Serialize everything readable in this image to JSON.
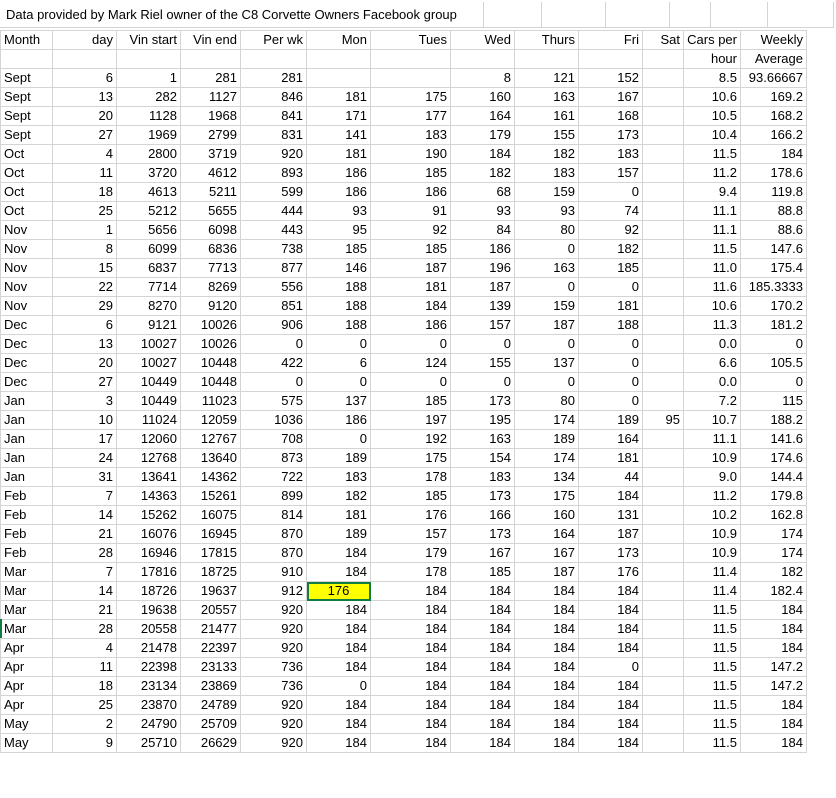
{
  "title": "Data provided by Mark Riel owner of the C8 Corvette Owners Facebook group",
  "headers": [
    "Month",
    "day",
    "Vin start",
    "Vin end",
    "Per wk",
    "Mon",
    "Tues",
    "Wed",
    "Thurs",
    "Fri",
    "Sat",
    "Cars per",
    "Weekly"
  ],
  "headers2": [
    "",
    "",
    "",
    "",
    "",
    "",
    "",
    "",
    "",
    "",
    "",
    "hour",
    "Average"
  ],
  "highlight": {
    "row": 27,
    "col": 5,
    "color": "#ffff00"
  },
  "rows": [
    [
      "Sept",
      "6",
      "1",
      "281",
      "281",
      "",
      "",
      "8",
      "121",
      "152",
      "",
      "8.5",
      "93.66667"
    ],
    [
      "Sept",
      "13",
      "282",
      "1127",
      "846",
      "181",
      "175",
      "160",
      "163",
      "167",
      "",
      "10.6",
      "169.2"
    ],
    [
      "Sept",
      "20",
      "1128",
      "1968",
      "841",
      "171",
      "177",
      "164",
      "161",
      "168",
      "",
      "10.5",
      "168.2"
    ],
    [
      "Sept",
      "27",
      "1969",
      "2799",
      "831",
      "141",
      "183",
      "179",
      "155",
      "173",
      "",
      "10.4",
      "166.2"
    ],
    [
      "Oct",
      "4",
      "2800",
      "3719",
      "920",
      "181",
      "190",
      "184",
      "182",
      "183",
      "",
      "11.5",
      "184"
    ],
    [
      "Oct",
      "11",
      "3720",
      "4612",
      "893",
      "186",
      "185",
      "182",
      "183",
      "157",
      "",
      "11.2",
      "178.6"
    ],
    [
      "Oct",
      "18",
      "4613",
      "5211",
      "599",
      "186",
      "186",
      "68",
      "159",
      "0",
      "",
      "9.4",
      "119.8"
    ],
    [
      "Oct",
      "25",
      "5212",
      "5655",
      "444",
      "93",
      "91",
      "93",
      "93",
      "74",
      "",
      "11.1",
      "88.8"
    ],
    [
      "Nov",
      "1",
      "5656",
      "6098",
      "443",
      "95",
      "92",
      "84",
      "80",
      "92",
      "",
      "11.1",
      "88.6"
    ],
    [
      "Nov",
      "8",
      "6099",
      "6836",
      "738",
      "185",
      "185",
      "186",
      "0",
      "182",
      "",
      "11.5",
      "147.6"
    ],
    [
      "Nov",
      "15",
      "6837",
      "7713",
      "877",
      "146",
      "187",
      "196",
      "163",
      "185",
      "",
      "11.0",
      "175.4"
    ],
    [
      "Nov",
      "22",
      "7714",
      "8269",
      "556",
      "188",
      "181",
      "187",
      "0",
      "0",
      "",
      "11.6",
      "185.3333"
    ],
    [
      "Nov",
      "29",
      "8270",
      "9120",
      "851",
      "188",
      "184",
      "139",
      "159",
      "181",
      "",
      "10.6",
      "170.2"
    ],
    [
      "Dec",
      "6",
      "9121",
      "10026",
      "906",
      "188",
      "186",
      "157",
      "187",
      "188",
      "",
      "11.3",
      "181.2"
    ],
    [
      "Dec",
      "13",
      "10027",
      "10026",
      "0",
      "0",
      "0",
      "0",
      "0",
      "0",
      "",
      "0.0",
      "0"
    ],
    [
      "Dec",
      "20",
      "10027",
      "10448",
      "422",
      "6",
      "124",
      "155",
      "137",
      "0",
      "",
      "6.6",
      "105.5"
    ],
    [
      "Dec",
      "27",
      "10449",
      "10448",
      "0",
      "0",
      "0",
      "0",
      "0",
      "0",
      "",
      "0.0",
      "0"
    ],
    [
      "Jan",
      "3",
      "10449",
      "11023",
      "575",
      "137",
      "185",
      "173",
      "80",
      "0",
      "",
      "7.2",
      "115"
    ],
    [
      "Jan",
      "10",
      "11024",
      "12059",
      "1036",
      "186",
      "197",
      "195",
      "174",
      "189",
      "95",
      "10.7",
      "188.2"
    ],
    [
      "Jan",
      "17",
      "12060",
      "12767",
      "708",
      "0",
      "192",
      "163",
      "189",
      "164",
      "",
      "11.1",
      "141.6"
    ],
    [
      "Jan",
      "24",
      "12768",
      "13640",
      "873",
      "189",
      "175",
      "154",
      "174",
      "181",
      "",
      "10.9",
      "174.6"
    ],
    [
      "Jan",
      "31",
      "13641",
      "14362",
      "722",
      "183",
      "178",
      "183",
      "134",
      "44",
      "",
      "9.0",
      "144.4"
    ],
    [
      "Feb",
      "7",
      "14363",
      "15261",
      "899",
      "182",
      "185",
      "173",
      "175",
      "184",
      "",
      "11.2",
      "179.8"
    ],
    [
      "Feb",
      "14",
      "15262",
      "16075",
      "814",
      "181",
      "176",
      "166",
      "160",
      "131",
      "",
      "10.2",
      "162.8"
    ],
    [
      "Feb",
      "21",
      "16076",
      "16945",
      "870",
      "189",
      "157",
      "173",
      "164",
      "187",
      "",
      "10.9",
      "174"
    ],
    [
      "Feb",
      "28",
      "16946",
      "17815",
      "870",
      "184",
      "179",
      "167",
      "167",
      "173",
      "",
      "10.9",
      "174"
    ],
    [
      "Mar",
      "7",
      "17816",
      "18725",
      "910",
      "184",
      "178",
      "185",
      "187",
      "176",
      "",
      "11.4",
      "182"
    ],
    [
      "Mar",
      "14",
      "18726",
      "19637",
      "912",
      "176",
      "184",
      "184",
      "184",
      "184",
      "",
      "11.4",
      "182.4"
    ],
    [
      "Mar",
      "21",
      "19638",
      "20557",
      "920",
      "184",
      "184",
      "184",
      "184",
      "184",
      "",
      "11.5",
      "184"
    ],
    [
      "Mar",
      "28",
      "20558",
      "21477",
      "920",
      "184",
      "184",
      "184",
      "184",
      "184",
      "",
      "11.5",
      "184"
    ],
    [
      "Apr",
      "4",
      "21478",
      "22397",
      "920",
      "184",
      "184",
      "184",
      "184",
      "184",
      "",
      "11.5",
      "184"
    ],
    [
      "Apr",
      "11",
      "22398",
      "23133",
      "736",
      "184",
      "184",
      "184",
      "184",
      "0",
      "",
      "11.5",
      "147.2"
    ],
    [
      "Apr",
      "18",
      "23134",
      "23869",
      "736",
      "0",
      "184",
      "184",
      "184",
      "184",
      "",
      "11.5",
      "147.2"
    ],
    [
      "Apr",
      "25",
      "23870",
      "24789",
      "920",
      "184",
      "184",
      "184",
      "184",
      "184",
      "",
      "11.5",
      "184"
    ],
    [
      "May",
      "2",
      "24790",
      "25709",
      "920",
      "184",
      "184",
      "184",
      "184",
      "184",
      "",
      "11.5",
      "184"
    ],
    [
      "May",
      "9",
      "25710",
      "26629",
      "920",
      "184",
      "184",
      "184",
      "184",
      "184",
      "",
      "11.5",
      "184"
    ]
  ]
}
